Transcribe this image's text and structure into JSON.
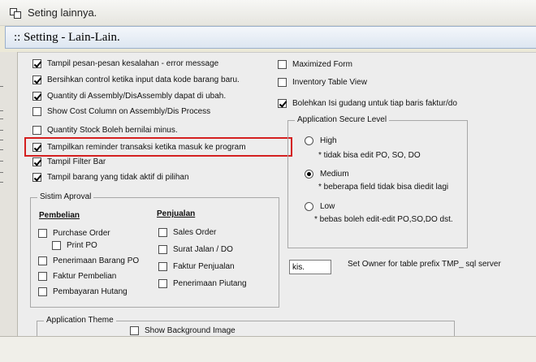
{
  "window": {
    "title": "Seting lainnya."
  },
  "header": {
    "title": ":: Setting - Lain-Lain."
  },
  "left_options": [
    {
      "label": "Tampil pesan-pesan kesalahan - error message",
      "checked": true
    },
    {
      "label": "Bersihkan control ketika input data kode barang baru.",
      "checked": true
    },
    {
      "label": "Quantity di Assembly/DisAssembly dapat di ubah.",
      "checked": true
    },
    {
      "label": "Show Cost Column on Assembly/Dis Process",
      "checked": false
    },
    {
      "label": "Quantity Stock Boleh bernilai minus.",
      "checked": false
    },
    {
      "label": "Tampilkan reminder transaksi ketika masuk ke program",
      "checked": true
    },
    {
      "label": "Tampil Filter Bar",
      "checked": true
    },
    {
      "label": "Tampil barang yang tidak aktif di pilihan",
      "checked": true
    }
  ],
  "right_options": [
    {
      "label": "Maximized Form",
      "checked": false
    },
    {
      "label": "Inventory Table View",
      "checked": false
    },
    {
      "label": "Bolehkan Isi gudang untuk tiap baris faktur/do",
      "checked": true
    }
  ],
  "security": {
    "legend": "Application Secure Level",
    "levels": [
      {
        "label": "High",
        "note": "* tidak bisa edit PO, SO, DO",
        "selected": false
      },
      {
        "label": "Medium",
        "note": "* beberapa field tidak bisa diedit lagi",
        "selected": true
      },
      {
        "label": "Low",
        "note": "* bebas boleh edit-edit PO,SO,DO dst.",
        "selected": false
      }
    ]
  },
  "approval": {
    "legend": "Sistim Aproval",
    "pembelian": {
      "title": "Pembelian",
      "items": [
        {
          "label": "Purchase Order",
          "checked": false
        },
        {
          "label": "Print PO",
          "checked": false
        },
        {
          "label": "Penerimaan Barang PO",
          "checked": false
        },
        {
          "label": "Faktur Pembelian",
          "checked": false
        },
        {
          "label": "Pembayaran Hutang",
          "checked": false
        }
      ]
    },
    "penjualan": {
      "title": "Penjualan",
      "items": [
        {
          "label": "Sales Order",
          "checked": false
        },
        {
          "label": "Surat Jalan / DO",
          "checked": false
        },
        {
          "label": "Faktur Penjualan",
          "checked": false
        },
        {
          "label": "Penerimaan Piutang",
          "checked": false
        }
      ]
    }
  },
  "owner": {
    "value": "kis.",
    "label": "Set Owner for table prefix TMP_ sql server"
  },
  "theme": {
    "legend": "Application Theme",
    "show_background": {
      "label": "Show Background Image",
      "checked": false
    }
  },
  "colors": {
    "highlight": "#d42020",
    "header_band": "#dde6f1"
  }
}
